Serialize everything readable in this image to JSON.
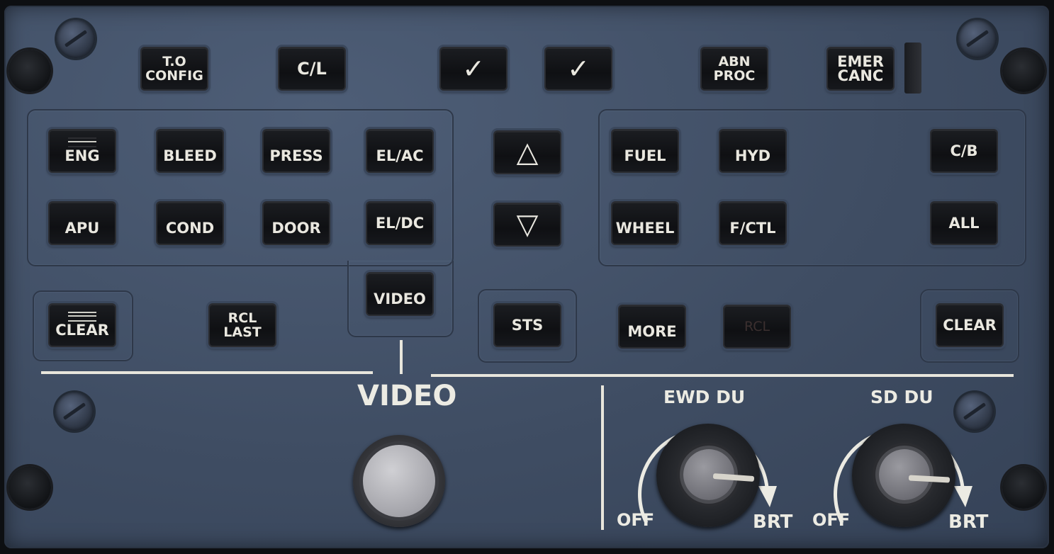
{
  "top_row": {
    "to_config": "T.O\nCONFIG",
    "cl": "C/L",
    "check1": "✓",
    "check2": "✓",
    "abn_proc": "ABN\nPROC",
    "emer_canc": "EMER\nCANC"
  },
  "left_group": {
    "eng": "ENG",
    "bleed": "BLEED",
    "press": "PRESS",
    "el_ac": "EL/AC",
    "apu": "APU",
    "cond": "COND",
    "door": "DOOR",
    "el_dc": "EL/DC",
    "video": "VIDEO"
  },
  "nav": {
    "up": "△",
    "down": "▽"
  },
  "right_group": {
    "fuel": "FUEL",
    "hyd": "HYD",
    "cb": "C/B",
    "wheel": "WHEEL",
    "fctl": "F/CTL",
    "all": "ALL"
  },
  "bottom_row": {
    "clear_left": "CLEAR",
    "rcl_last": "RCL\nLAST",
    "sts": "STS",
    "more": "MORE",
    "rcl": "RCL",
    "clear_right": "CLEAR"
  },
  "lower": {
    "video_label": "VIDEO",
    "ewd_label": "EWD DU",
    "sd_label": "SD DU",
    "off": "OFF",
    "brt": "BRT"
  }
}
